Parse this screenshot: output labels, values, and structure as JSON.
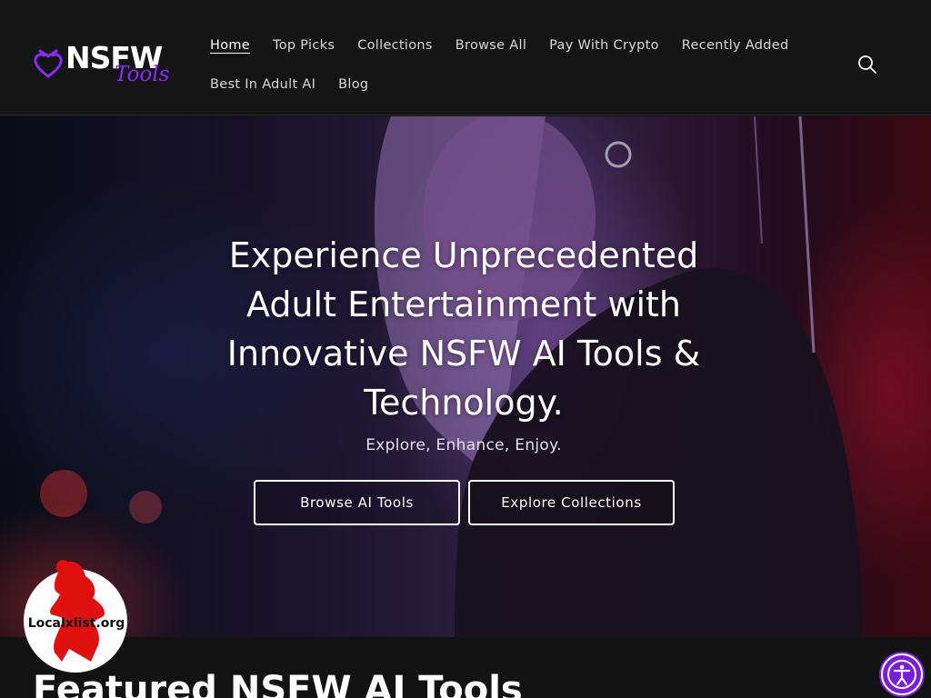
{
  "header": {
    "logo_main": "NSFW",
    "logo_sub": "Tools",
    "nav_row1": [
      "Home",
      "Top Picks",
      "Collections",
      "Browse All",
      "Pay With Crypto",
      "Recently Added"
    ],
    "nav_row2": [
      "Best In Adult AI",
      "Blog"
    ],
    "active_item": "Home",
    "search_icon": "search-icon"
  },
  "hero": {
    "title": "Experience Unprecedented Adult Entertainment with Innovative NSFW AI Tools & Technology.",
    "subtitle": "Explore, Enhance, Enjoy.",
    "buttons": {
      "browse": "Browse AI Tools",
      "explore": "Explore Collections"
    }
  },
  "watermark": {
    "text": "Localxlist.org"
  },
  "featured": {
    "heading": "Featured NSFW AI Tools"
  },
  "accessibility": {
    "icon": "accessibility-icon"
  },
  "colors": {
    "brand_purple": "#8a28ff",
    "header_bg": "#151515",
    "page_bg": "#121212",
    "a11y_purple": "#7a1fd6",
    "badge_red": "#e01010"
  }
}
